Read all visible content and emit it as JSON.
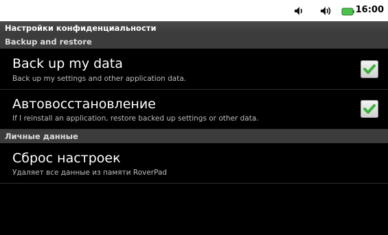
{
  "status_bar": {
    "icons": [
      "volume-icon",
      "volume-icon",
      "battery-icon"
    ],
    "time": "16:00"
  },
  "title": "Настройки конфиденциальности",
  "sections": [
    {
      "header": "Backup and restore",
      "items": [
        {
          "title": "Back up my data",
          "summary": "Back up my settings and other application data.",
          "checked": true
        },
        {
          "title": "Автовосстановление",
          "summary": "If I reinstall an application, restore backed up settings or other data.",
          "checked": true
        }
      ]
    },
    {
      "header": "Личные данные",
      "items": [
        {
          "title": "Сброс настроек",
          "summary": "Удаляет все данные из памяти RoverPad"
        }
      ]
    }
  ],
  "colors": {
    "check_green": "#3bb33b",
    "battery_green": "#4cc14c"
  }
}
